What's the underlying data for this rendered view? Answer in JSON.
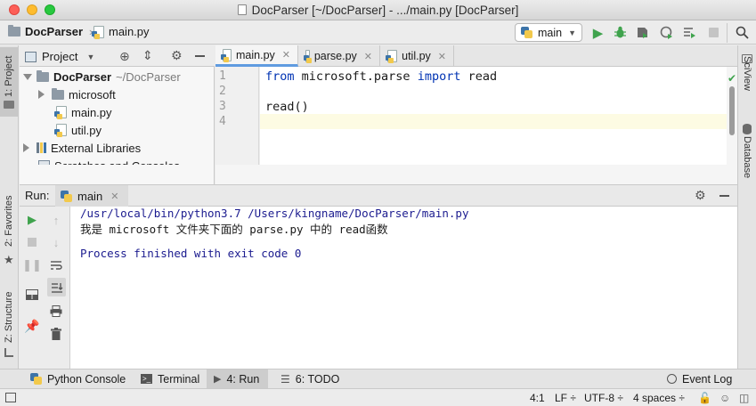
{
  "window": {
    "title": "DocParser [~/DocParser] - .../main.py [DocParser]",
    "traffic_lights": {
      "close": "#fd5f57",
      "minimize": "#febc2e",
      "zoom": "#28c840"
    }
  },
  "navbar": {
    "project_crumb": "DocParser",
    "file_crumb": "main.py",
    "run_config": "main"
  },
  "project_pane": {
    "view_label": "Project",
    "tree": [
      {
        "label": "DocParser",
        "suffix": "~/DocParser",
        "type": "folder",
        "expanded": true
      },
      {
        "label": "microsoft",
        "type": "folder",
        "expanded": false
      },
      {
        "label": "main.py",
        "type": "python-file"
      },
      {
        "label": "util.py",
        "type": "python-file"
      },
      {
        "label": "External Libraries",
        "type": "library",
        "expanded": false
      },
      {
        "label": "Scratches and Consoles",
        "type": "scratch"
      }
    ]
  },
  "editor": {
    "tabs": [
      {
        "label": "main.py",
        "active": true
      },
      {
        "label": "parse.py",
        "active": false
      },
      {
        "label": "util.py",
        "active": false
      }
    ],
    "line_numbers": [
      "1",
      "2",
      "3",
      "4"
    ],
    "lines": [
      {
        "kw1": "from",
        "mid": " microsoft.parse ",
        "kw2": "import",
        "tail": " read"
      },
      {
        "text": ""
      },
      {
        "text": "read()"
      },
      {
        "text": ""
      }
    ],
    "current_line": "4"
  },
  "run_panel": {
    "label": "Run:",
    "tab": "main",
    "output": [
      "/usr/local/bin/python3.7 /Users/kingname/DocParser/main.py",
      "我是 microsoft 文件夹下面的 parse.py 中的 read函数",
      "",
      "Process finished with exit code 0"
    ]
  },
  "left_strip": {
    "project_tab": "1: Project",
    "favorites_tab": "2: Favorites",
    "structure_tab": "Z: Structure"
  },
  "right_strip": {
    "sciview_tab": "SciView",
    "database_tab": "Database"
  },
  "bottom_tabs": {
    "python_console": "Python Console",
    "terminal": "Terminal",
    "run": "4: Run",
    "todo": "6: TODO",
    "event_log": "Event Log"
  },
  "status_bar": {
    "position": "4:1",
    "line_separator": "LF ÷",
    "encoding": "UTF-8 ÷",
    "indent": "4 spaces ÷"
  },
  "colors": {
    "accent_tab": "#5f9be0",
    "run_green": "#3fa34d",
    "keyword": "#0033b3",
    "console_blue": "#1b1b8f",
    "current_line": "#fdfbe3"
  }
}
